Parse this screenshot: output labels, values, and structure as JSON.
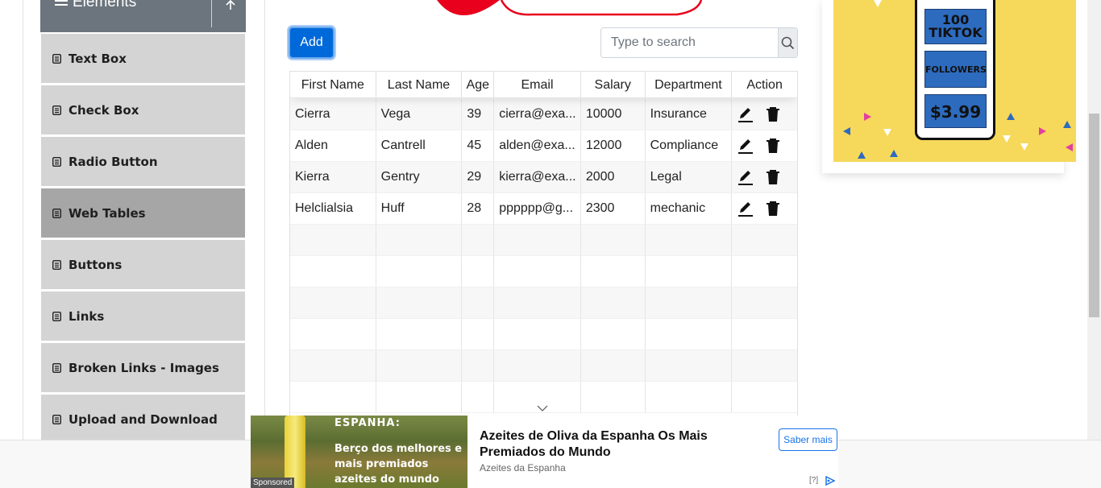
{
  "sidebar": {
    "group_title": "Elements",
    "items": [
      {
        "label": "Text Box",
        "active": false
      },
      {
        "label": "Check Box",
        "active": false
      },
      {
        "label": "Radio Button",
        "active": false
      },
      {
        "label": "Web Tables",
        "active": true
      },
      {
        "label": "Buttons",
        "active": false
      },
      {
        "label": "Links",
        "active": false
      },
      {
        "label": "Broken Links - Images",
        "active": false
      },
      {
        "label": "Upload and Download",
        "active": false
      }
    ]
  },
  "toolbar": {
    "add_label": "Add",
    "search_placeholder": "Type to search",
    "search_value": ""
  },
  "table": {
    "columns": [
      "First Name",
      "Last Name",
      "Age",
      "Email",
      "Salary",
      "Department",
      "Action"
    ],
    "rows": [
      {
        "first": "Cierra",
        "last": "Vega",
        "age": "39",
        "email": "cierra@exa...",
        "salary": "10000",
        "dept": "Insurance"
      },
      {
        "first": "Alden",
        "last": "Cantrell",
        "age": "45",
        "email": "alden@exa...",
        "salary": "12000",
        "dept": "Compliance"
      },
      {
        "first": "Kierra",
        "last": "Gentry",
        "age": "29",
        "email": "kierra@exa...",
        "salary": "2000",
        "dept": "Legal"
      },
      {
        "first": "Helclialsia",
        "last": "Huff",
        "age": "28",
        "email": "pppppp@g...",
        "salary": "2300",
        "dept": "mechanic"
      }
    ],
    "empty_rows": 6
  },
  "right_ad": {
    "box1": "100 TIKTOK",
    "box2": "FOLLOWERS",
    "box3": "$3.99"
  },
  "bottom_ad": {
    "image_headline": "ESPANHA:",
    "image_tagline": "Berço dos melhores e mais premiados azeites do mundo",
    "sponsored": "Sponsored",
    "title": "Azeites de Oliva da Espanha Os Mais Premiados do Mundo",
    "source": "Azeites da Espanha",
    "cta": "Saber mais",
    "info": "[?]"
  },
  "colors": {
    "primary": "#0069d9",
    "sidebar_bg": "#d4d4d4",
    "sidebar_active": "#a6a6a6",
    "group_header": "#6c757d",
    "ad_yellow": "#f6d85a",
    "ad_blue": "#2d6bbf"
  }
}
